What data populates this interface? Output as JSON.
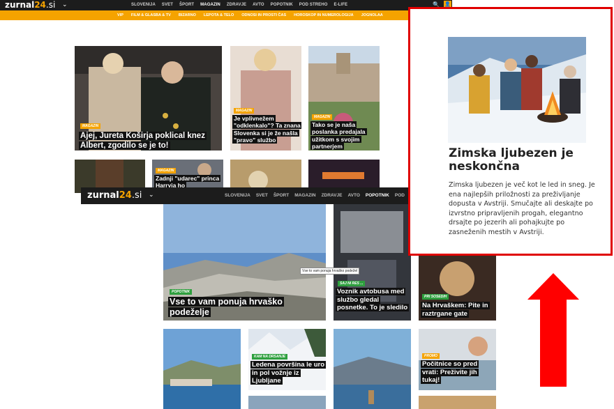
{
  "topbar": {
    "logo_main": "zurnal",
    "logo_num": "24",
    "logo_dom": ".si",
    "nav": [
      "SLOVENIJA",
      "SVET",
      "ŠPORT",
      "MAGAZIN",
      "ZDRAVJE",
      "AVTO",
      "POPOTNIK",
      "POD STREHO",
      "E-LIFE"
    ],
    "active": "MAGAZIN"
  },
  "subbar": {
    "nav": [
      "VIP",
      "FILM & GLASBA & TV",
      "BIZARNO",
      "LEPOTA & TELO",
      "ODNOSI IN PROSTI ČAS",
      "HOROSKOP IN NUMEROLOGIJA",
      "JOGNOLAA"
    ]
  },
  "articles_top": [
    {
      "tag": "MAGAZIN",
      "headline": "Ajej, Jureta Koširja poklical knez Albert, zgodilo se je to!"
    },
    {
      "tag": "MAGAZIN",
      "headline": "Je vplivnežem \"odklenkalo\"? Ta znana Slovenka si je že našla \"pravo\" službo"
    },
    {
      "tag": "MAGAZIN",
      "headline": "Tako se je naša poslanka predajala užitkom s svojim partnerjem"
    },
    {
      "tag": "MAGAZIN",
      "headline": "Zadnji \"udarec\" princa Harryja ho"
    }
  ],
  "shot2": {
    "logo_main": "zurnal",
    "logo_num": "24",
    "logo_dom": ".si",
    "nav": [
      "SLOVENIJA",
      "SVET",
      "ŠPORT",
      "MAGAZIN",
      "ZDRAVJE",
      "AVTO",
      "POPOTNIK",
      "POD STR"
    ],
    "active": "POPOTNIK",
    "tooltip": "Vse to vam ponuja hrvaško podežel",
    "articles": [
      {
        "tag": "POPOTNIK",
        "headline": "Vse to vam ponuja hrvaško podeželje"
      },
      {
        "tag": "SAJ NI RES ...",
        "headline": "Voznik avtobusa med službo gledal posnetke. To je sledilo"
      },
      {
        "tag": "PRI SOSEDIH",
        "headline": "Na Hrvaškem: Pite in raztrgane gate"
      },
      {
        "tag": "KAM NA DRSANJE",
        "headline": "Ledena površina le uro in pol vožnje iz Ljubljane"
      },
      {
        "tag": "PROMO",
        "headline": "Počitnice so pred vrati: Preživite jih tukaj!"
      }
    ]
  },
  "side": {
    "title": "Zimska ljubezen je neskončna",
    "body": "Zimska ljubezen je več kot le led in sneg. Je ena najlepših priložnosti za preživljanje dopusta v Avstriji. Smučajte ali deskajte po izvrstno pripravljenih progah, elegantno drsajte po jezerih ali pohajkujte po zasneženih mestih v Avstriji."
  },
  "colors": {
    "accent": "#f5a300",
    "highlight": "#e00000",
    "green_tag": "#2e9f3e"
  }
}
